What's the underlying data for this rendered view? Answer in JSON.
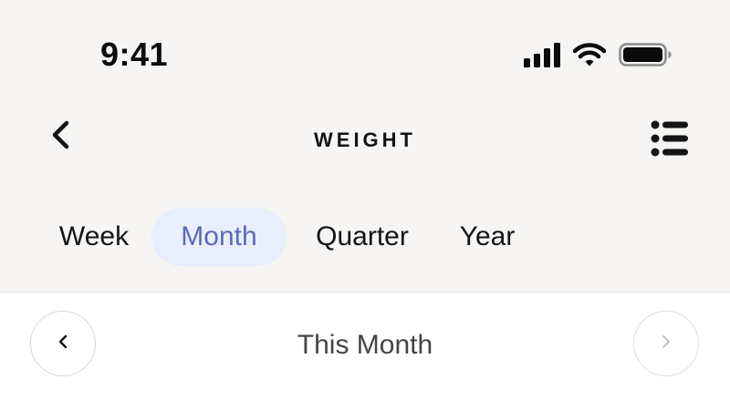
{
  "status_bar": {
    "time": "9:41",
    "icons": [
      "signal-icon",
      "wifi-icon",
      "battery-icon"
    ]
  },
  "header": {
    "title": "WEIGHT",
    "back_icon": "chevron-left-icon",
    "menu_icon": "list-icon"
  },
  "tabs": [
    {
      "label": "Week",
      "selected": false
    },
    {
      "label": "Month",
      "selected": true
    },
    {
      "label": "Quarter",
      "selected": false
    },
    {
      "label": "Year",
      "selected": false
    }
  ],
  "period_nav": {
    "label": "This Month",
    "prev_icon": "chevron-left-icon",
    "next_icon": "chevron-right-icon",
    "next_enabled": false
  },
  "colors": {
    "top_background": "#f6f5f3",
    "selected_tab_background": "#e9eefd",
    "selected_tab_text": "#5a6ab8",
    "text_primary": "#141414",
    "disabled_icon": "#c4c4c4"
  }
}
